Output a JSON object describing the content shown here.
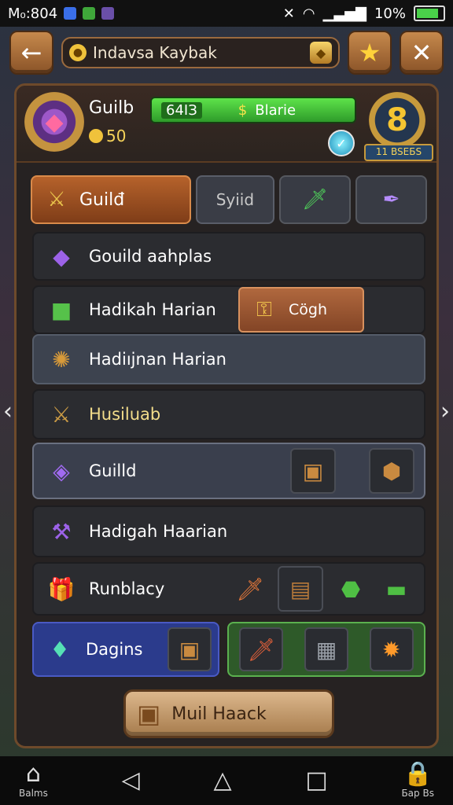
{
  "status_bar": {
    "time": "M₀:804",
    "battery": "10%",
    "battery_fill": 0.9
  },
  "top_bar": {
    "back_icon": "arrow-left-icon",
    "search_text": "Indavsa Kaybak",
    "star_icon": "star-icon",
    "close_icon": "close-icon"
  },
  "header": {
    "title": "Guilb",
    "coins": "50",
    "bar_value": "64IЗ",
    "bar_label": "Blarie",
    "bar_symbol": "$",
    "level": "8",
    "level_plate": "11 BSEБS"
  },
  "tabs": [
    {
      "label": "Guilđ",
      "active": true
    },
    {
      "label": "Syiid",
      "active": false
    }
  ],
  "rows": [
    {
      "label": "Gouild aahplas"
    },
    {
      "label": "Hadikah Harian",
      "chip_label": "Cögh"
    },
    {
      "label": "Hadiıjnan Harian"
    },
    {
      "label": "Husiluab"
    },
    {
      "label": "Guilld"
    },
    {
      "label": "Hadigah Haarian"
    },
    {
      "label": "Runblacy"
    }
  ],
  "bottom_box": {
    "label": "Dagins"
  },
  "cta": {
    "label": "Muil Haack"
  },
  "nav": {
    "left_label": "Balms",
    "right_label": "Бар Bs"
  },
  "colors": {
    "accent_brown": "#8a5328",
    "health_green": "#2e9b2a",
    "gold": "#f0c23b"
  }
}
